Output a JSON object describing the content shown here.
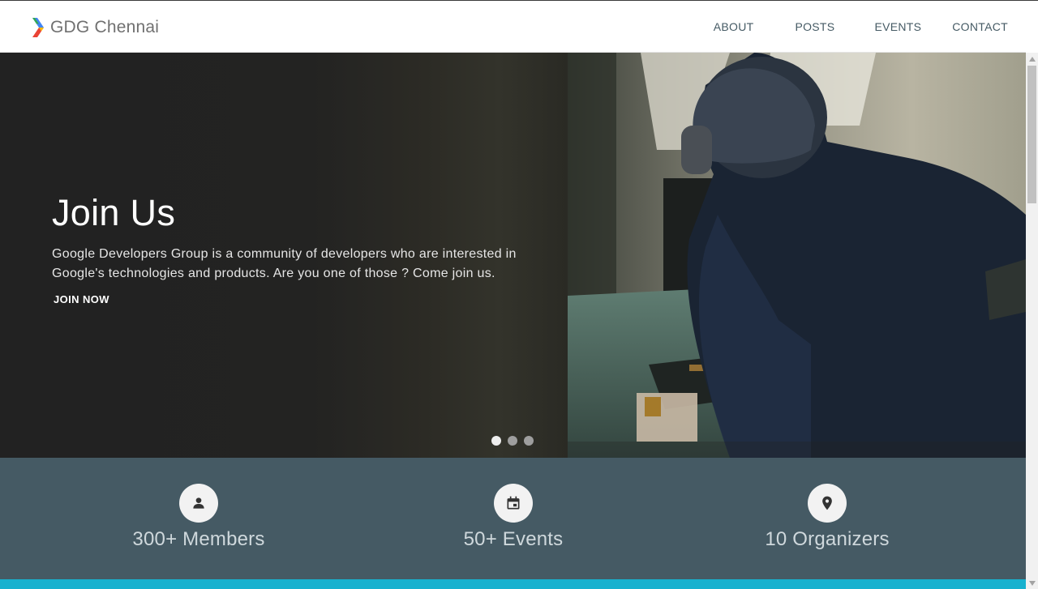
{
  "header": {
    "logo_text": "GDG Chennai",
    "nav": [
      "ABOUT",
      "POSTS",
      "EVENTS",
      "CONTACT"
    ]
  },
  "hero": {
    "title": "Join Us",
    "description": "Google Developers Group is a community of developers who are interested in Google's technologies and products. Are you one of those ? Come join us.",
    "button_label": "JOIN NOW",
    "slide_count": 3,
    "active_slide": 1
  },
  "stats": [
    {
      "icon": "person-icon",
      "label": "300+ Members"
    },
    {
      "icon": "calendar-icon",
      "label": "50+ Events"
    },
    {
      "icon": "location-pin-icon",
      "label": "10 Organizers"
    }
  ],
  "colors": {
    "nav_text": "#455a64",
    "stats_background": "#455a64",
    "bottom_band": "#17b1cf"
  }
}
